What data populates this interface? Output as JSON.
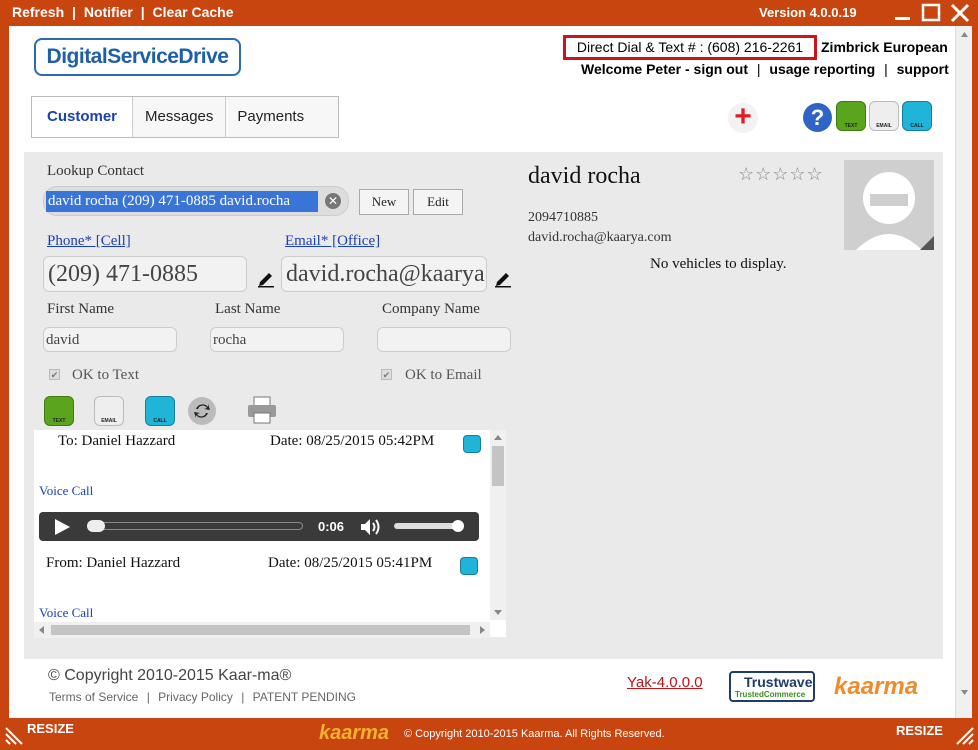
{
  "titlebar": {
    "refresh": "Refresh",
    "notifier": "Notifier",
    "clear_cache": "Clear Cache",
    "sep": "|",
    "version": "Version 4.0.0.19"
  },
  "header": {
    "logo": "DigitalServiceDrive",
    "direct_dial": "Direct Dial & Text # : (608) 216-2261",
    "dealer": "Zimbrick European",
    "welcome": "Welcome Peter - sign out",
    "usage": "usage reporting",
    "support": "support",
    "sep": "|"
  },
  "tabs": [
    "Customer",
    "Messages",
    "Payments"
  ],
  "icons": {
    "text_label": "TEXT",
    "email_label": "EMAIL",
    "call_label": "CALL"
  },
  "form": {
    "lookup_label": "Lookup Contact",
    "lookup_value": "david rocha (209) 471-0885 david.rocha",
    "new_button": "New",
    "edit_button": "Edit",
    "phone_label": "Phone* [Cell]",
    "phone_value": "(209) 471-0885",
    "email_label": "Email* [Office]",
    "email_value": "david.rocha@kaarya",
    "first_name_label": "First Name",
    "first_name": "david",
    "last_name_label": "Last Name",
    "last_name": "rocha",
    "company_label": "Company Name",
    "company": "",
    "ok_text": "OK to Text",
    "ok_email": "OK to Email"
  },
  "messages": [
    {
      "party": "To: Daniel Hazzard",
      "date": "Date: 08/25/2015 05:42PM",
      "type": "Voice Call"
    },
    {
      "party": "From: Daniel Hazzard",
      "date": "Date: 08/25/2015 05:41PM",
      "type": "Voice Call"
    }
  ],
  "player": {
    "time": "0:06"
  },
  "contact": {
    "name": "david rocha",
    "phone": "2094710885",
    "email": "david.rocha@kaarya.com",
    "vehicles": "No vehicles to display.",
    "rating": 0
  },
  "footer": {
    "copyright": "© Copyright 2010-2015 Kaar-ma®",
    "terms": "Terms of Service",
    "privacy": "Privacy Policy",
    "patent": "PATENT PENDING",
    "sep": "|",
    "yak": "Yak-4.0.0.0",
    "trustwave": "Trustwave",
    "trusted_commerce": "TrustedCommerce",
    "kaarma": "kaarma"
  },
  "bottombar": {
    "resize": "RESIZE",
    "logo": "kaarma",
    "copyright": "© Copyright 2010-2015 Kaarma.  All Rights Reserved."
  },
  "colors": {
    "brand": "#c8450f",
    "link": "#1a3fb8",
    "alert": "#d0121b"
  }
}
